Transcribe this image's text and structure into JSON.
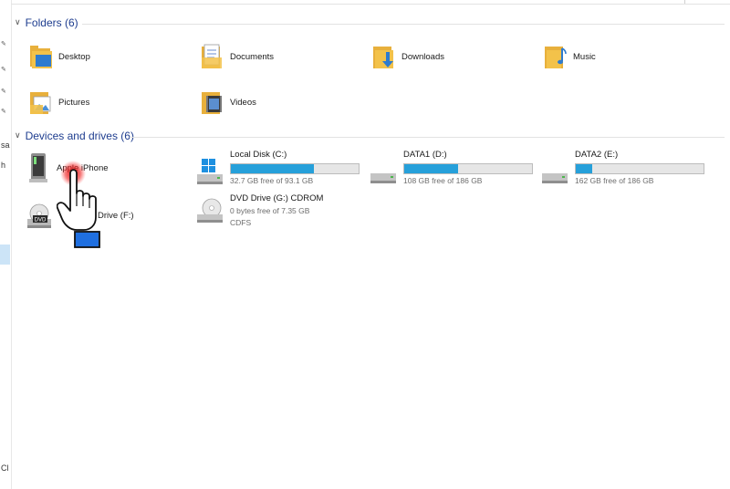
{
  "folders": {
    "header": "Folders (6)",
    "items": [
      {
        "label": "Desktop",
        "icon": "desktop-folder-icon"
      },
      {
        "label": "Documents",
        "icon": "documents-folder-icon"
      },
      {
        "label": "Downloads",
        "icon": "downloads-folder-icon"
      },
      {
        "label": "Music",
        "icon": "music-folder-icon"
      },
      {
        "label": "Pictures",
        "icon": "pictures-folder-icon"
      },
      {
        "label": "Videos",
        "icon": "videos-folder-icon"
      }
    ]
  },
  "devices": {
    "header": "Devices and drives (6)",
    "apple_iphone": {
      "label": "Apple iPhone",
      "icon": "iphone-device-icon"
    },
    "dvd_rw": {
      "label": "DVD RW Drive (F:)",
      "icon": "dvd-drive-icon"
    },
    "drives": [
      {
        "name": "Local Disk (C:)",
        "free_text": "32.7 GB free of 93.1 GB",
        "used_fraction": 0.65,
        "icon": "windows-disk-icon"
      },
      {
        "name": "DATA1 (D:)",
        "free_text": "108 GB free of 186 GB",
        "used_fraction": 0.42,
        "icon": "hard-drive-icon"
      },
      {
        "name": "DATA2 (E:)",
        "free_text": "162 GB free of 186 GB",
        "used_fraction": 0.13,
        "icon": "hard-drive-icon"
      }
    ],
    "cdrom": {
      "name": "DVD Drive (G:) CDROM",
      "line1": "0 bytes free of 7.35 GB",
      "line2": "CDFS",
      "icon": "cd-drive-icon"
    }
  },
  "sidebar": {
    "fragments": [
      "sa",
      "h",
      "Cl"
    ]
  },
  "colors": {
    "accent": "#26a0da",
    "header_text": "#1e3d8f",
    "folder_yellow": "#f3c24a"
  }
}
